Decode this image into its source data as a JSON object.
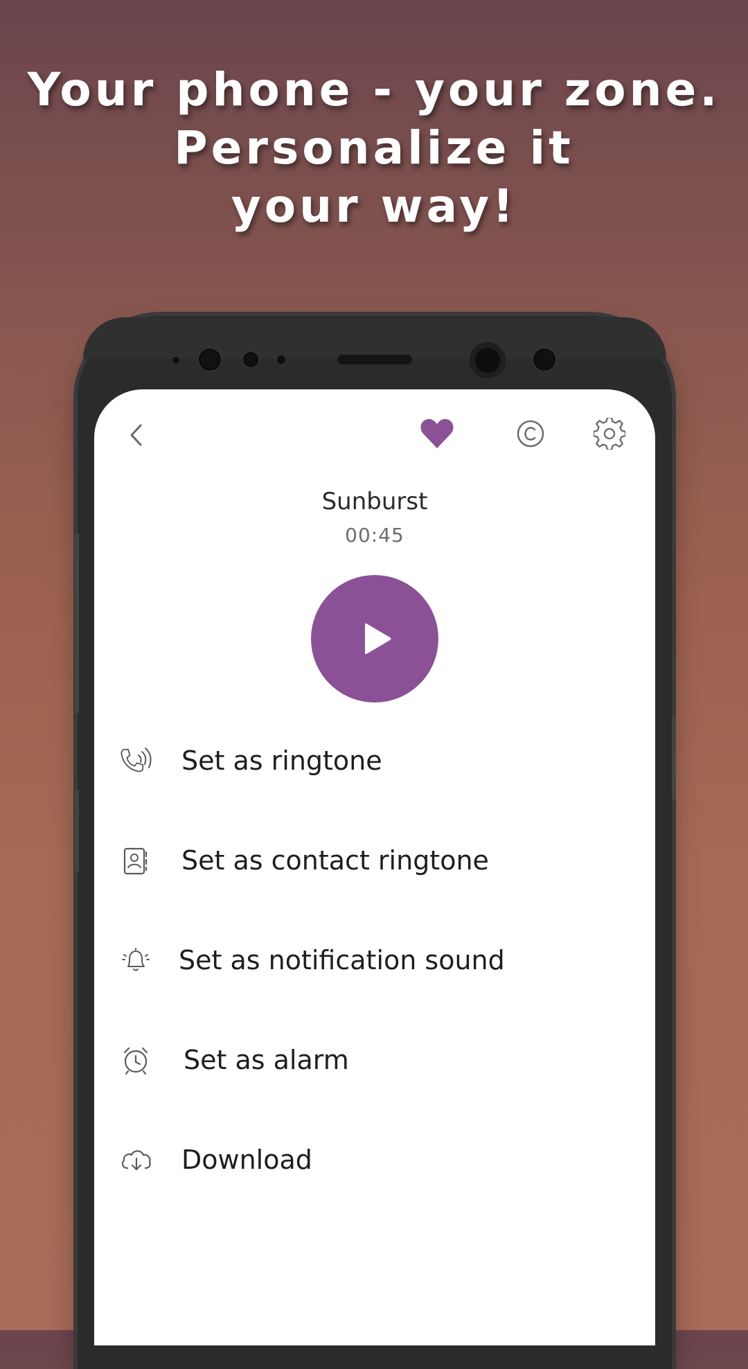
{
  "promo": {
    "line1": "Your phone - your zone.",
    "line2": "Personalize it",
    "line3": "your way!"
  },
  "header": {
    "back_icon": "chevron-left-icon",
    "favorite_icon": "heart-icon",
    "copyright_icon": "copyright-icon",
    "settings_icon": "gear-icon",
    "accent_color": "#8b5196"
  },
  "track": {
    "title": "Sunburst",
    "duration": "00:45"
  },
  "player": {
    "play_icon": "play-icon"
  },
  "menu": {
    "items": [
      {
        "label": "Set as ringtone",
        "icon": "phone-ringing-icon"
      },
      {
        "label": "Set as contact ringtone",
        "icon": "contact-card-icon"
      },
      {
        "label": "Set as notification sound",
        "icon": "bell-icon"
      },
      {
        "label": "Set as alarm",
        "icon": "alarm-clock-icon"
      },
      {
        "label": "Download",
        "icon": "cloud-download-icon"
      }
    ]
  }
}
